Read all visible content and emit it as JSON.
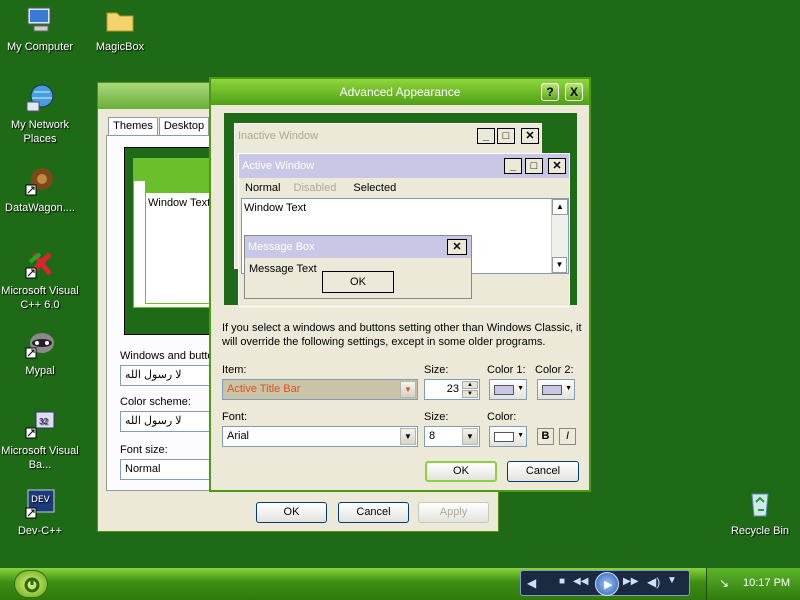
{
  "desktop": {
    "icons": [
      {
        "label": "My Computer",
        "icon": "computer-icon"
      },
      {
        "label": "MagicBox",
        "icon": "folder-icon"
      },
      {
        "label": "My Network Places",
        "icon": "network-icon"
      },
      {
        "label": "DataWagon....",
        "icon": "shortcut-icon"
      },
      {
        "label": "Microsoft Visual C++ 6.0",
        "icon": "shortcut-icon"
      },
      {
        "label": "Mypal",
        "icon": "shortcut-icon"
      },
      {
        "label": "Microsoft Visual Ba...",
        "icon": "shortcut-icon"
      },
      {
        "label": "Dev-C++",
        "icon": "shortcut-icon"
      },
      {
        "label": "Recycle Bin",
        "icon": "recycle-bin-icon"
      }
    ]
  },
  "display_properties": {
    "tabs": [
      "Themes",
      "Desktop"
    ],
    "preview_window_text": "Window Text",
    "windows_buttons_label": "Windows and butto",
    "windows_buttons_value": "لا رسول الله",
    "color_scheme_label": "Color scheme:",
    "color_scheme_value": "لا رسول الله",
    "font_size_label": "Font size:",
    "font_size_value": "Normal",
    "ok": "OK",
    "cancel": "Cancel",
    "apply": "Apply"
  },
  "advanced": {
    "title": "Advanced Appearance",
    "help_glyph": "?",
    "close_glyph": "X",
    "preview": {
      "inactive_title": "Inactive Window",
      "active_title": "Active Window",
      "menu": [
        "Normal",
        "Disabled",
        "Selected"
      ],
      "window_text": "Window Text",
      "message_box_title": "Message Box",
      "message_text": "Message Text",
      "message_ok": "OK"
    },
    "info": "If you select a windows and buttons setting other than Windows Classic, it will override the following settings, except in some older programs.",
    "item_label": "Item:",
    "item_value": "Active Title Bar",
    "size_label": "Size:",
    "size_value": "23",
    "color1_label": "Color 1:",
    "color2_label": "Color 2:",
    "font_label": "Font:",
    "font_value": "Arial",
    "font_size_label": "Size:",
    "font_size_value": "8",
    "color_label": "Color:",
    "bold": "B",
    "italic": "I",
    "ok": "OK",
    "cancel": "Cancel"
  },
  "taskbar": {
    "clock": "10:17 PM"
  },
  "colors": {
    "desktop": "#1e6a16",
    "accent": "#6bbf2a"
  }
}
